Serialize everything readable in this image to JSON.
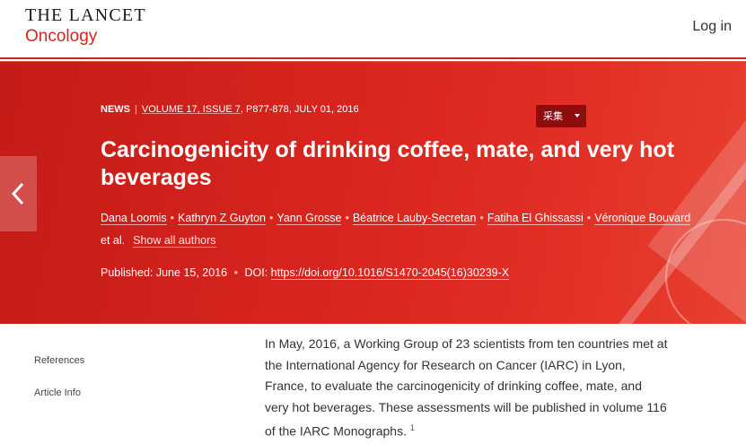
{
  "header": {
    "logo_line1": "THE LANCET",
    "logo_line2": "Oncology",
    "login_label": "Log in"
  },
  "article": {
    "type": "NEWS",
    "issue": "VOLUME 17, ISSUE 7",
    "pages_date": ", P877-878, JULY 01, 2016",
    "title": "Carcinogenicity of drinking coffee, mate, and very hot beverages",
    "authors": [
      "Dana Loomis",
      "Kathryn Z Guyton",
      "Yann Grosse",
      "Béatrice Lauby-Secretan",
      "Fatiha El Ghissassi",
      "Véronique Bouvard"
    ],
    "etal": "et al.",
    "show_all_label": "Show all authors",
    "published_label": "Published:",
    "published_date": "June 15, 2016",
    "doi_label": "DOI:",
    "doi_link": "https://doi.org/10.1016/S1470-2045(16)30239-X"
  },
  "collect_button": "采集",
  "sidenav": {
    "references": "References",
    "article_info": "Article Info"
  },
  "body": {
    "paragraph": "In May, 2016, a Working Group of 23 scientists from ten countries met at the International Agency for Research on Cancer (IARC) in Lyon, France, to evaluate the carcinogenicity of drinking coffee, mate, and very hot beverages. These assessments will be published in volume 116 of the IARC Monographs.",
    "ref_marker": "1"
  },
  "colors": {
    "brand_red": "#c41c18",
    "logo_red": "#d0271e",
    "link_blue": "#2a5ca8"
  },
  "icons": {
    "prev": "chevron-left-icon",
    "dropdown": "caret-down-icon"
  }
}
